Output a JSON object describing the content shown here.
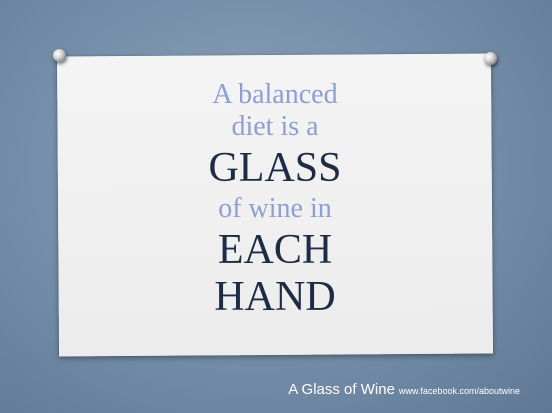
{
  "quote": {
    "line1": "A balanced",
    "line2": "diet is a",
    "line3": "GLASS",
    "line4": "of wine in",
    "line5": "EACH",
    "line6": "HAND"
  },
  "footer": {
    "brand": "A Glass of Wine",
    "url": "www.facebook.com/aboutwine"
  },
  "colors": {
    "background": "#7891ab",
    "card": "#efefef",
    "light_text": "#8d9fd2",
    "dark_text": "#1d2b45"
  }
}
